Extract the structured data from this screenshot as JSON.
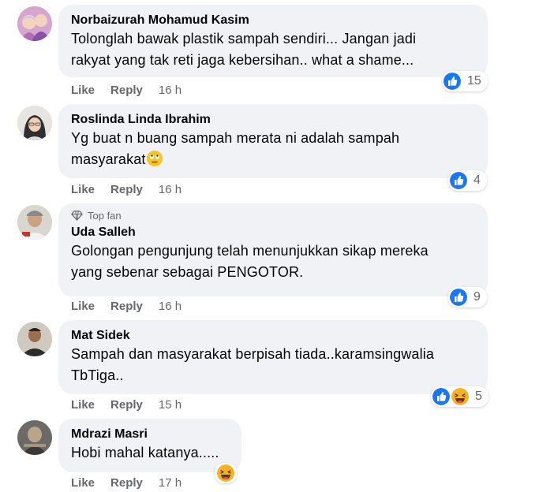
{
  "comments": [
    {
      "author": "Norbaizurah Mohamud Kasim",
      "text_lines": [
        "Tolonglah bawak plastik sampah sendiri... Jangan jadi",
        "rakyat yang tak reti jaga kebersihan.. what a shame..."
      ],
      "like": "Like",
      "reply": "Reply",
      "time": "16 h",
      "reaction_count": "15",
      "reactions": [
        "like-icon"
      ]
    },
    {
      "author": "Roslinda Linda Ibrahim",
      "text_lines": [
        "Yg buat n buang sampah merata ni adalah sampah",
        "masyarakat"
      ],
      "inline_emoji": "face-with-rolling-eyes-icon",
      "like": "Like",
      "reply": "Reply",
      "time": "16 h",
      "reaction_count": "4",
      "reactions": [
        "like-icon"
      ]
    },
    {
      "badge": "Top fan",
      "author": "Uda Salleh",
      "text_lines": [
        "Golongan pengunjung telah menunjukkan sikap mereka",
        "yang sebenar sebagai PENGOTOR."
      ],
      "like": "Like",
      "reply": "Reply",
      "time": "16 h",
      "reaction_count": "9",
      "reactions": [
        "like-icon"
      ]
    },
    {
      "author": "Mat Sidek",
      "text_lines": [
        "Sampah dan masyarakat berpisah tiada..karamsingwalia",
        "TbTiga.."
      ],
      "like": "Like",
      "reply": "Reply",
      "time": "15 h",
      "reaction_count": "5",
      "reactions": [
        "like-icon",
        "haha-icon"
      ]
    },
    {
      "author": "Mdrazi Masri",
      "text_lines": [
        "Hobi mahal katanya....."
      ],
      "like": "Like",
      "reply": "Reply",
      "time": "17 h",
      "reactions": [
        "haha-icon"
      ]
    }
  ],
  "colors": {
    "like_blue": "#1877f2",
    "bubble_bg": "#f0f2f5",
    "meta_gray": "#65676b",
    "haha_yellow": "#f7b125"
  }
}
